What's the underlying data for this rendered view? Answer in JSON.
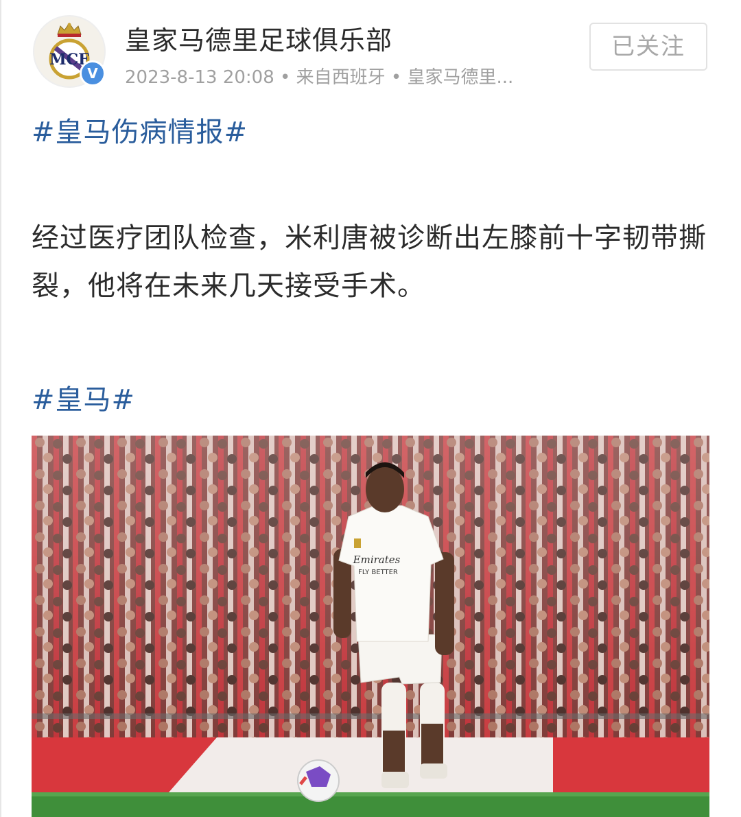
{
  "post": {
    "account_name": "皇家马德里足球俱乐部",
    "meta": "2023-8-13 20:08 • 来自西班牙 • 皇家马德里...",
    "verified_badge": "V",
    "follow_button": "已关注",
    "hashtag_1": "#皇马伤病情报#",
    "body": "经过医疗团队检查，米利唐被诊断出左膝前十字韧带撕裂，他将在未来几天接受手术。",
    "hashtag_2": "#皇马#"
  },
  "photo": {
    "jersey_sponsor": "Emirates",
    "jersey_slogan": "FLY BETTER"
  },
  "colors": {
    "hashtag": "#2a5d9c",
    "verified": "#4a8fe0",
    "crowd_red": "#c8323a",
    "pitch": "#3f8f3a"
  },
  "icons": {
    "avatar": "real-madrid-crest-icon",
    "verified": "verified-icon"
  }
}
